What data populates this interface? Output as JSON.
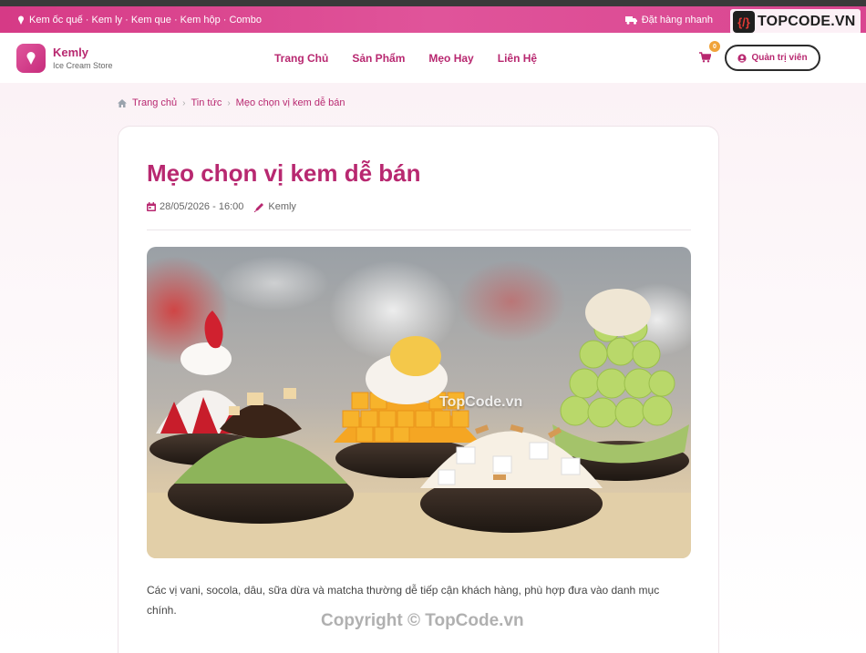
{
  "promo": {
    "left_text": "Kem ốc quế · Kem ly · Kem que · Kem hộp · Combo",
    "right_text": "Đặt hàng nhanh"
  },
  "brand": {
    "name": "Kemly",
    "tagline": "Ice Cream Store"
  },
  "nav": {
    "items": [
      {
        "label": "Trang Chủ"
      },
      {
        "label": "Sản Phẩm"
      },
      {
        "label": "Mẹo Hay"
      },
      {
        "label": "Liên Hệ"
      }
    ]
  },
  "cart": {
    "count": "0"
  },
  "admin": {
    "label": "Quản trị viên"
  },
  "watermark": {
    "logo_text": "TOPCODE.VN",
    "center_text": "TopCode.vn",
    "bottom_text": "Copyright © TopCode.vn"
  },
  "breadcrumb": {
    "items": [
      {
        "label": "Trang chủ"
      },
      {
        "label": "Tin tức"
      },
      {
        "label": "Mẹo chọn vị kem dễ bán"
      }
    ]
  },
  "article": {
    "title": "Mẹo chọn vị kem dễ bán",
    "date": "28/05/2026 - 16:00",
    "author": "Kemly",
    "body": "Các vị vani, socola, dâu, sữa dừa và matcha thường dễ tiếp cận khách hàng, phù hợp đưa vào danh mục chính."
  },
  "colors": {
    "brand": "#b82870",
    "promo_bar": "#e0549a",
    "badge": "#f0a33a"
  }
}
